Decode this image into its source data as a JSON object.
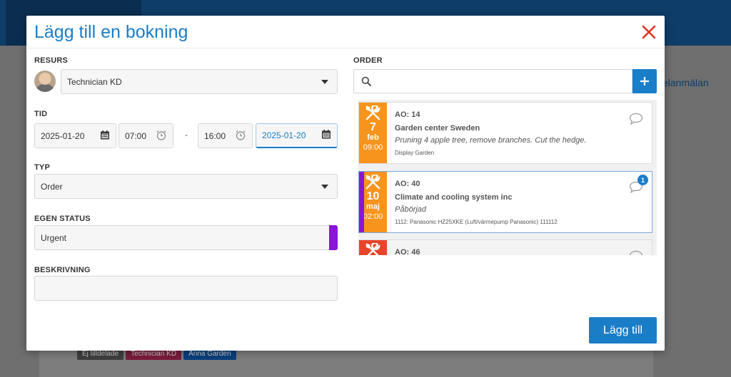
{
  "background": {
    "link_text": "elanmälan",
    "chips": [
      {
        "label": "Ej tilldelade",
        "color": "#3f3f3f"
      },
      {
        "label": "Technician KD",
        "color": "#7a1c3c"
      },
      {
        "label": "Anna Garden",
        "color": "#0b3f7d"
      }
    ]
  },
  "modal": {
    "title": "Lägg till en bokning",
    "submit_label": "Lägg till"
  },
  "form": {
    "resource_label": "RESURS",
    "resource_value": "Technician KD",
    "time_label": "TID",
    "start_date": "2025-01-20",
    "start_time": "07:00",
    "dash": "-",
    "end_time": "16:00",
    "end_date": "2025-01-20",
    "type_label": "TYP",
    "type_value": "Order",
    "status_label": "EGEN STATUS",
    "status_value": "Urgent",
    "status_color": "#8b16d2",
    "description_label": "BESKRIVNING",
    "description_value": ""
  },
  "orders": {
    "label": "ORDER",
    "search_placeholder": "",
    "items": [
      {
        "ao": "AO: 14",
        "customer": "Garden center Sweden",
        "description": "Pruning 4 apple tree, remove branches. Cut the hedge.",
        "sub": "Display Garden",
        "day": "7",
        "month": "feb",
        "time": "09:00",
        "color": "#f7941d",
        "comments": ""
      },
      {
        "ao": "AO: 40",
        "customer": "Climate and cooling system inc",
        "description": "Påbörjad",
        "sub": "1112: Panasonic HZ25XKE (Luft/värmepump Panasonic) 111112",
        "day": "10",
        "month": "maj",
        "time": "02:00",
        "color": "#f7941d",
        "comments": "1"
      },
      {
        "ao": "AO: 46",
        "color": "#e8452b"
      }
    ]
  }
}
